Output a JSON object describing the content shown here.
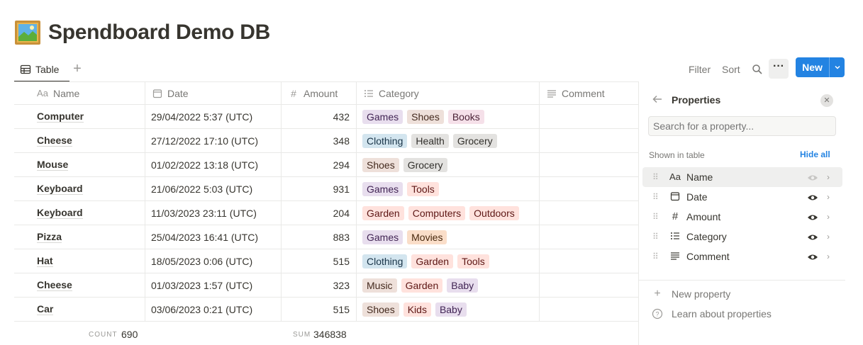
{
  "page": {
    "title": "Spendboard Demo DB",
    "icon": "framed-picture-icon"
  },
  "views": {
    "active_tab": "Table",
    "tab_icon": "table-icon",
    "add_icon": "plus-icon"
  },
  "toolbar": {
    "filter": "Filter",
    "sort": "Sort",
    "search_icon": "search-icon",
    "more_icon": "more-icon",
    "new_label": "New",
    "new_dropdown_icon": "chevron-down-icon",
    "accent_color": "#2383e2"
  },
  "table": {
    "columns": [
      {
        "label": "Name",
        "icon": "Aa"
      },
      {
        "label": "Date",
        "icon": "calendar-icon"
      },
      {
        "label": "Amount",
        "icon": "#"
      },
      {
        "label": "Category",
        "icon": "list-icon"
      },
      {
        "label": "Comment",
        "icon": "text-icon"
      }
    ],
    "rows": [
      {
        "name": "Computer",
        "date": "29/04/2022 5:37 (UTC)",
        "amount": "432",
        "categories": [
          "Games",
          "Shoes",
          "Books"
        ],
        "comment": ""
      },
      {
        "name": "Cheese",
        "date": "27/12/2022 17:10 (UTC)",
        "amount": "348",
        "categories": [
          "Clothing",
          "Health",
          "Grocery"
        ],
        "comment": ""
      },
      {
        "name": "Mouse",
        "date": "01/02/2022 13:18 (UTC)",
        "amount": "294",
        "categories": [
          "Shoes",
          "Grocery"
        ],
        "comment": ""
      },
      {
        "name": "Keyboard",
        "date": "21/06/2022 5:03 (UTC)",
        "amount": "931",
        "categories": [
          "Games",
          "Tools"
        ],
        "comment": ""
      },
      {
        "name": "Keyboard",
        "date": "11/03/2023 23:11 (UTC)",
        "amount": "204",
        "categories": [
          "Garden",
          "Computers",
          "Outdoors"
        ],
        "comment": ""
      },
      {
        "name": "Pizza",
        "date": "25/04/2023 16:41 (UTC)",
        "amount": "883",
        "categories": [
          "Games",
          "Movies"
        ],
        "comment": ""
      },
      {
        "name": "Hat",
        "date": "18/05/2023 0:06 (UTC)",
        "amount": "515",
        "categories": [
          "Clothing",
          "Garden",
          "Tools"
        ],
        "comment": ""
      },
      {
        "name": "Cheese",
        "date": "01/03/2023 1:57 (UTC)",
        "amount": "323",
        "categories": [
          "Music",
          "Garden",
          "Baby"
        ],
        "comment": ""
      },
      {
        "name": "Car",
        "date": "03/06/2023 0:21 (UTC)",
        "amount": "515",
        "categories": [
          "Shoes",
          "Kids",
          "Baby"
        ],
        "comment": ""
      }
    ],
    "tag_colors": {
      "Games": {
        "bg": "#e8deee",
        "fg": "#412454"
      },
      "Shoes": {
        "bg": "#eee0da",
        "fg": "#442a1e"
      },
      "Books": {
        "bg": "#f5e0e9",
        "fg": "#4c2337"
      },
      "Clothing": {
        "bg": "#d3e5ef",
        "fg": "#183347"
      },
      "Health": {
        "bg": "#e3e2e0",
        "fg": "#32302c"
      },
      "Grocery": {
        "bg": "#e3e2e0",
        "fg": "#32302c"
      },
      "Tools": {
        "bg": "#ffe2dd",
        "fg": "#5d1715"
      },
      "Garden": {
        "bg": "#ffe2dd",
        "fg": "#5d1715"
      },
      "Computers": {
        "bg": "#ffe2dd",
        "fg": "#5d1715"
      },
      "Outdoors": {
        "bg": "#ffe2dd",
        "fg": "#5d1715"
      },
      "Movies": {
        "bg": "#fadec9",
        "fg": "#49290e"
      },
      "Music": {
        "bg": "#eee0da",
        "fg": "#442a1e"
      },
      "Baby": {
        "bg": "#e8deee",
        "fg": "#412454"
      },
      "Kids": {
        "bg": "#ffe2dd",
        "fg": "#5d1715"
      }
    },
    "footer": {
      "count_label": "COUNT",
      "count_value": "690",
      "sum_label": "SUM",
      "sum_value": "346838"
    }
  },
  "properties_panel": {
    "title": "Properties",
    "back_icon": "arrow-left-icon",
    "close_icon": "close-icon",
    "search_placeholder": "Search for a property...",
    "shown_label": "Shown in table",
    "hide_all": "Hide all",
    "items": [
      {
        "name": "Name",
        "icon": "Aa",
        "visible": true,
        "locked": true
      },
      {
        "name": "Date",
        "icon": "calendar-icon",
        "visible": true
      },
      {
        "name": "Amount",
        "icon": "#",
        "visible": true
      },
      {
        "name": "Category",
        "icon": "list-icon",
        "visible": true
      },
      {
        "name": "Comment",
        "icon": "text-icon",
        "visible": true
      }
    ],
    "new_property": "New property",
    "learn_link": "Learn about properties"
  }
}
